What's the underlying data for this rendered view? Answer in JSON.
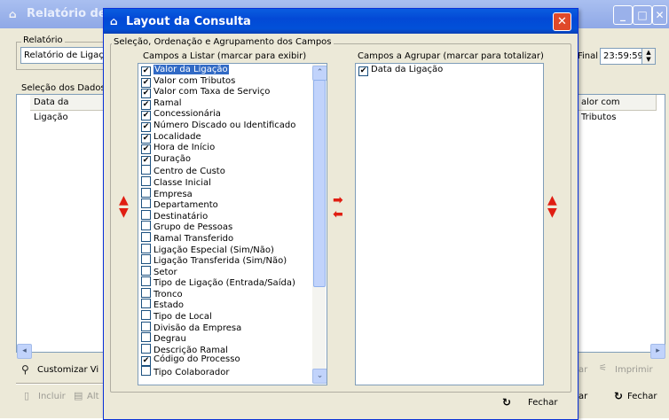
{
  "background_window": {
    "title": "Relatório de L",
    "logo_glyph": "⌂",
    "group_label": "Relatório",
    "report_field": "Relatório de Ligaçõ",
    "final_label": "Final",
    "final_time": "23:59:59",
    "selection_label": "Seleção dos Dados",
    "col_left": "Data da Ligação",
    "col_right": "alor com Tributos",
    "customize_label": "Customizar Vi",
    "print_label": "Imprimir",
    "print_prefix": "ar",
    "close_label": "Fechar",
    "close_prefix": "ar",
    "include_label": "Incluir",
    "alter_label": "Alt"
  },
  "dialog": {
    "title": "Layout da Consulta",
    "logo_glyph": "⌂",
    "group_label": "Seleção, Ordenação e Agrupamento dos Campos",
    "list_label": "Campos a Listar (marcar para exibir)",
    "group_list_label": "Campos a Agrupar (marcar para totalizar)",
    "close_button": "Fechar",
    "list_fields": [
      {
        "label": "Valor da Ligação",
        "checked": true,
        "selected": true
      },
      {
        "label": "Valor com Tributos",
        "checked": true,
        "selected": false
      },
      {
        "label": "Valor com Taxa de Serviço",
        "checked": true,
        "selected": false
      },
      {
        "label": "Ramal",
        "checked": true,
        "selected": false
      },
      {
        "label": "Concessionária",
        "checked": true,
        "selected": false
      },
      {
        "label": "Número Discado ou Identificado",
        "checked": true,
        "selected": false
      },
      {
        "label": "Localidade",
        "checked": true,
        "selected": false
      },
      {
        "label": "Hora de Início",
        "checked": true,
        "selected": false
      },
      {
        "label": "Duração",
        "checked": true,
        "selected": false
      },
      {
        "label": "Centro de Custo",
        "checked": false,
        "selected": false
      },
      {
        "label": "Classe Inicial",
        "checked": false,
        "selected": false
      },
      {
        "label": "Empresa",
        "checked": false,
        "selected": false
      },
      {
        "label": "Departamento",
        "checked": false,
        "selected": false
      },
      {
        "label": "Destinatário",
        "checked": false,
        "selected": false
      },
      {
        "label": "Grupo de Pessoas",
        "checked": false,
        "selected": false
      },
      {
        "label": "Ramal Transferido",
        "checked": false,
        "selected": false
      },
      {
        "label": "Ligação Especial (Sim/Não)",
        "checked": false,
        "selected": false
      },
      {
        "label": "Ligação Transferida (Sim/Não)",
        "checked": false,
        "selected": false
      },
      {
        "label": "Setor",
        "checked": false,
        "selected": false
      },
      {
        "label": "Tipo de Ligação (Entrada/Saída)",
        "checked": false,
        "selected": false
      },
      {
        "label": "Tronco",
        "checked": false,
        "selected": false
      },
      {
        "label": "Estado",
        "checked": false,
        "selected": false
      },
      {
        "label": "Tipo de Local",
        "checked": false,
        "selected": false
      },
      {
        "label": "Divisão da Empresa",
        "checked": false,
        "selected": false
      },
      {
        "label": "Degrau",
        "checked": false,
        "selected": false
      },
      {
        "label": "Descrição Ramal",
        "checked": false,
        "selected": false
      },
      {
        "label": "Código do Processo",
        "checked": true,
        "selected": false
      },
      {
        "label": "Tipo Colaborador",
        "checked": false,
        "selected": false
      }
    ],
    "group_fields": [
      {
        "label": "Data da Ligação",
        "checked": true
      }
    ]
  },
  "colors": {
    "dialog_title": "#0349d6",
    "close_button": "#e0492a",
    "selection": "#316ac5",
    "arrows": "#e01e12"
  }
}
